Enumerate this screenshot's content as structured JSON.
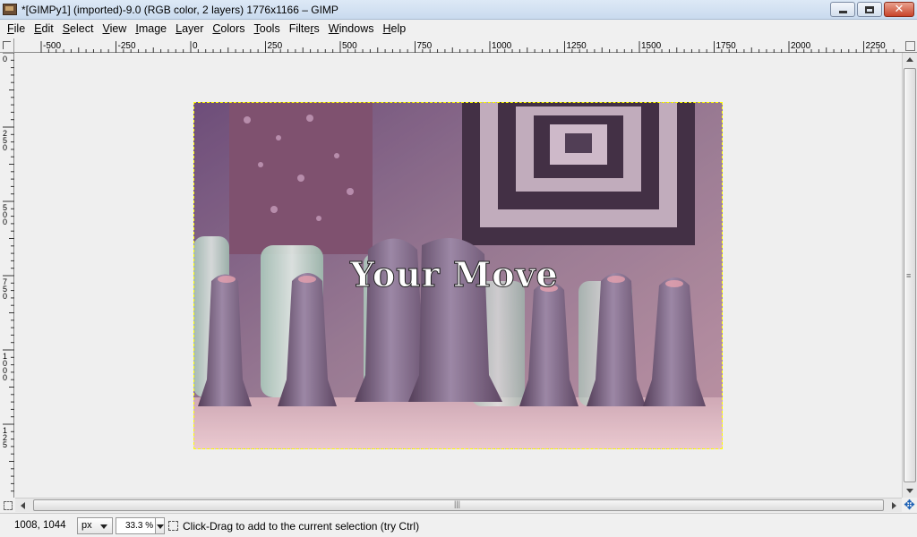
{
  "window": {
    "title": "*[GIMPy1] (imported)-9.0 (RGB color, 2 layers) 1776x1166 – GIMP"
  },
  "menu": [
    {
      "label": "File",
      "underline": "F",
      "rest": "ile"
    },
    {
      "label": "Edit",
      "underline": "E",
      "rest": "dit"
    },
    {
      "label": "Select",
      "underline": "S",
      "rest": "elect"
    },
    {
      "label": "View",
      "underline": "V",
      "rest": "iew"
    },
    {
      "label": "Image",
      "underline": "I",
      "rest": "mage"
    },
    {
      "label": "Layer",
      "underline": "L",
      "rest": "ayer"
    },
    {
      "label": "Colors",
      "underline": "C",
      "rest": "olors"
    },
    {
      "label": "Tools",
      "underline": "T",
      "rest": "ools"
    },
    {
      "label": "Filters",
      "underline": "r",
      "prefix": "Filte",
      "rest": "s"
    },
    {
      "label": "Windows",
      "underline": "W",
      "rest": "indows"
    },
    {
      "label": "Help",
      "underline": "H",
      "rest": "elp"
    }
  ],
  "rulers": {
    "horizontal_labels": [
      "-500",
      "-250",
      "0",
      "250",
      "500",
      "750",
      "1000",
      "1250",
      "1500",
      "1750",
      "2000",
      "2250"
    ],
    "vertical_labels": [
      "0",
      "250",
      "500",
      "750",
      "1000",
      "125"
    ]
  },
  "canvas": {
    "overlay_text": "Your Move"
  },
  "status": {
    "coords": "1008, 1044",
    "unit": "px",
    "zoom": "33.3 %",
    "message": "Click-Drag to add to the current selection (try Ctrl)"
  },
  "icons": {
    "app": "gimp-icon",
    "navigate": "navigate-icon",
    "quick_mask": "quick-mask-icon",
    "selection_status": "selection-icon"
  }
}
